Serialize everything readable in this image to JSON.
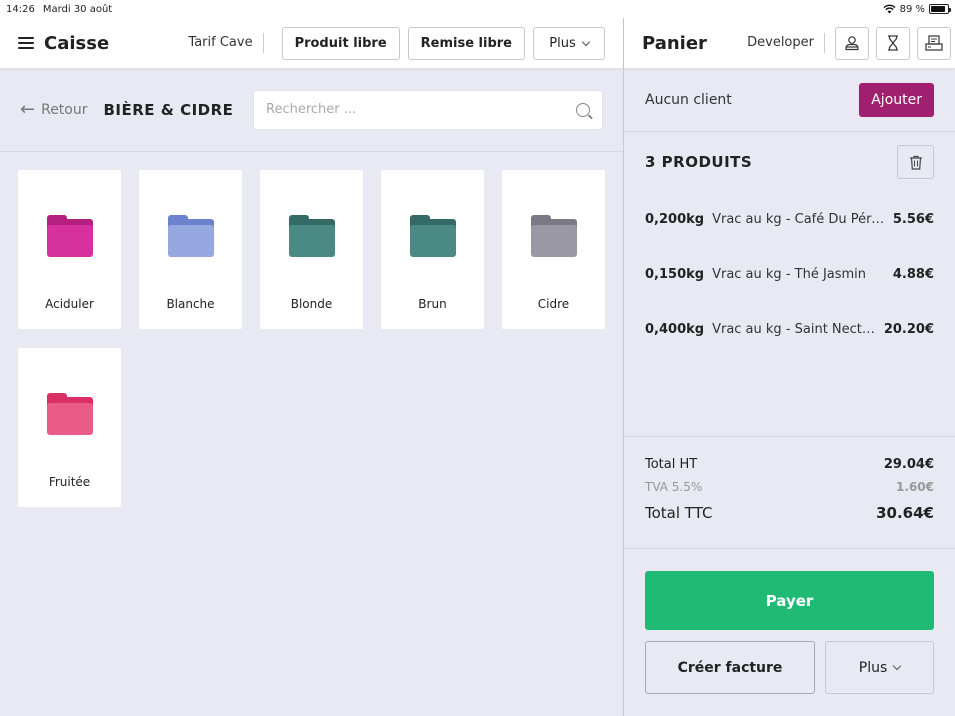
{
  "status_bar": {
    "time": "14:26",
    "date": "Mardi 30 août",
    "battery": "89 %",
    "battery_level": 0.89
  },
  "header": {
    "title": "Caisse",
    "tarif": "Tarif Cave",
    "buttons": {
      "produit_libre": "Produit libre",
      "remise_libre": "Remise libre",
      "plus": "Plus"
    }
  },
  "nav": {
    "back_label": "Retour",
    "category_title": "BIÈRE & CIDRE",
    "search_placeholder": "Rechercher ..."
  },
  "folders": [
    {
      "label": "Aciduler",
      "color": "#d6319f",
      "tab": "#b3207f"
    },
    {
      "label": "Blanche",
      "color": "#95a8e0",
      "tab": "#6d82cf"
    },
    {
      "label": "Blonde",
      "color": "#4b8a84",
      "tab": "#356b66"
    },
    {
      "label": "Brun",
      "color": "#4b8a84",
      "tab": "#356b66"
    },
    {
      "label": "Cidre",
      "color": "#9a98a4",
      "tab": "#7b7986"
    },
    {
      "label": "Fruitée",
      "color": "#ea5b87",
      "tab": "#d92f66"
    }
  ],
  "cart": {
    "title": "Panier",
    "user": "Developer",
    "no_client": "Aucun client",
    "add_label": "Ajouter",
    "count_label": "3 PRODUITS",
    "items": [
      {
        "qty": "0,200kg",
        "name": "Vrac au kg - Café Du Pérou",
        "price": "5.56€"
      },
      {
        "qty": "0,150kg",
        "name": "Vrac au kg - Thé Jasmin",
        "price": "4.88€"
      },
      {
        "qty": "0,400kg",
        "name": "Vrac au kg - Saint Nectaire",
        "price": "20.20€"
      }
    ],
    "totals": {
      "ht_label": "Total HT",
      "ht_value": "29.04€",
      "tva_label": "TVA 5.5%",
      "tva_value": "1.60€",
      "ttc_label": "Total TTC",
      "ttc_value": "30.64€"
    },
    "pay_label": "Payer",
    "invoice_label": "Créer facture",
    "more_label": "Plus"
  },
  "colors": {
    "accent": "#a0206f",
    "pay": "#1fbb75",
    "background": "#e8e9f2"
  }
}
